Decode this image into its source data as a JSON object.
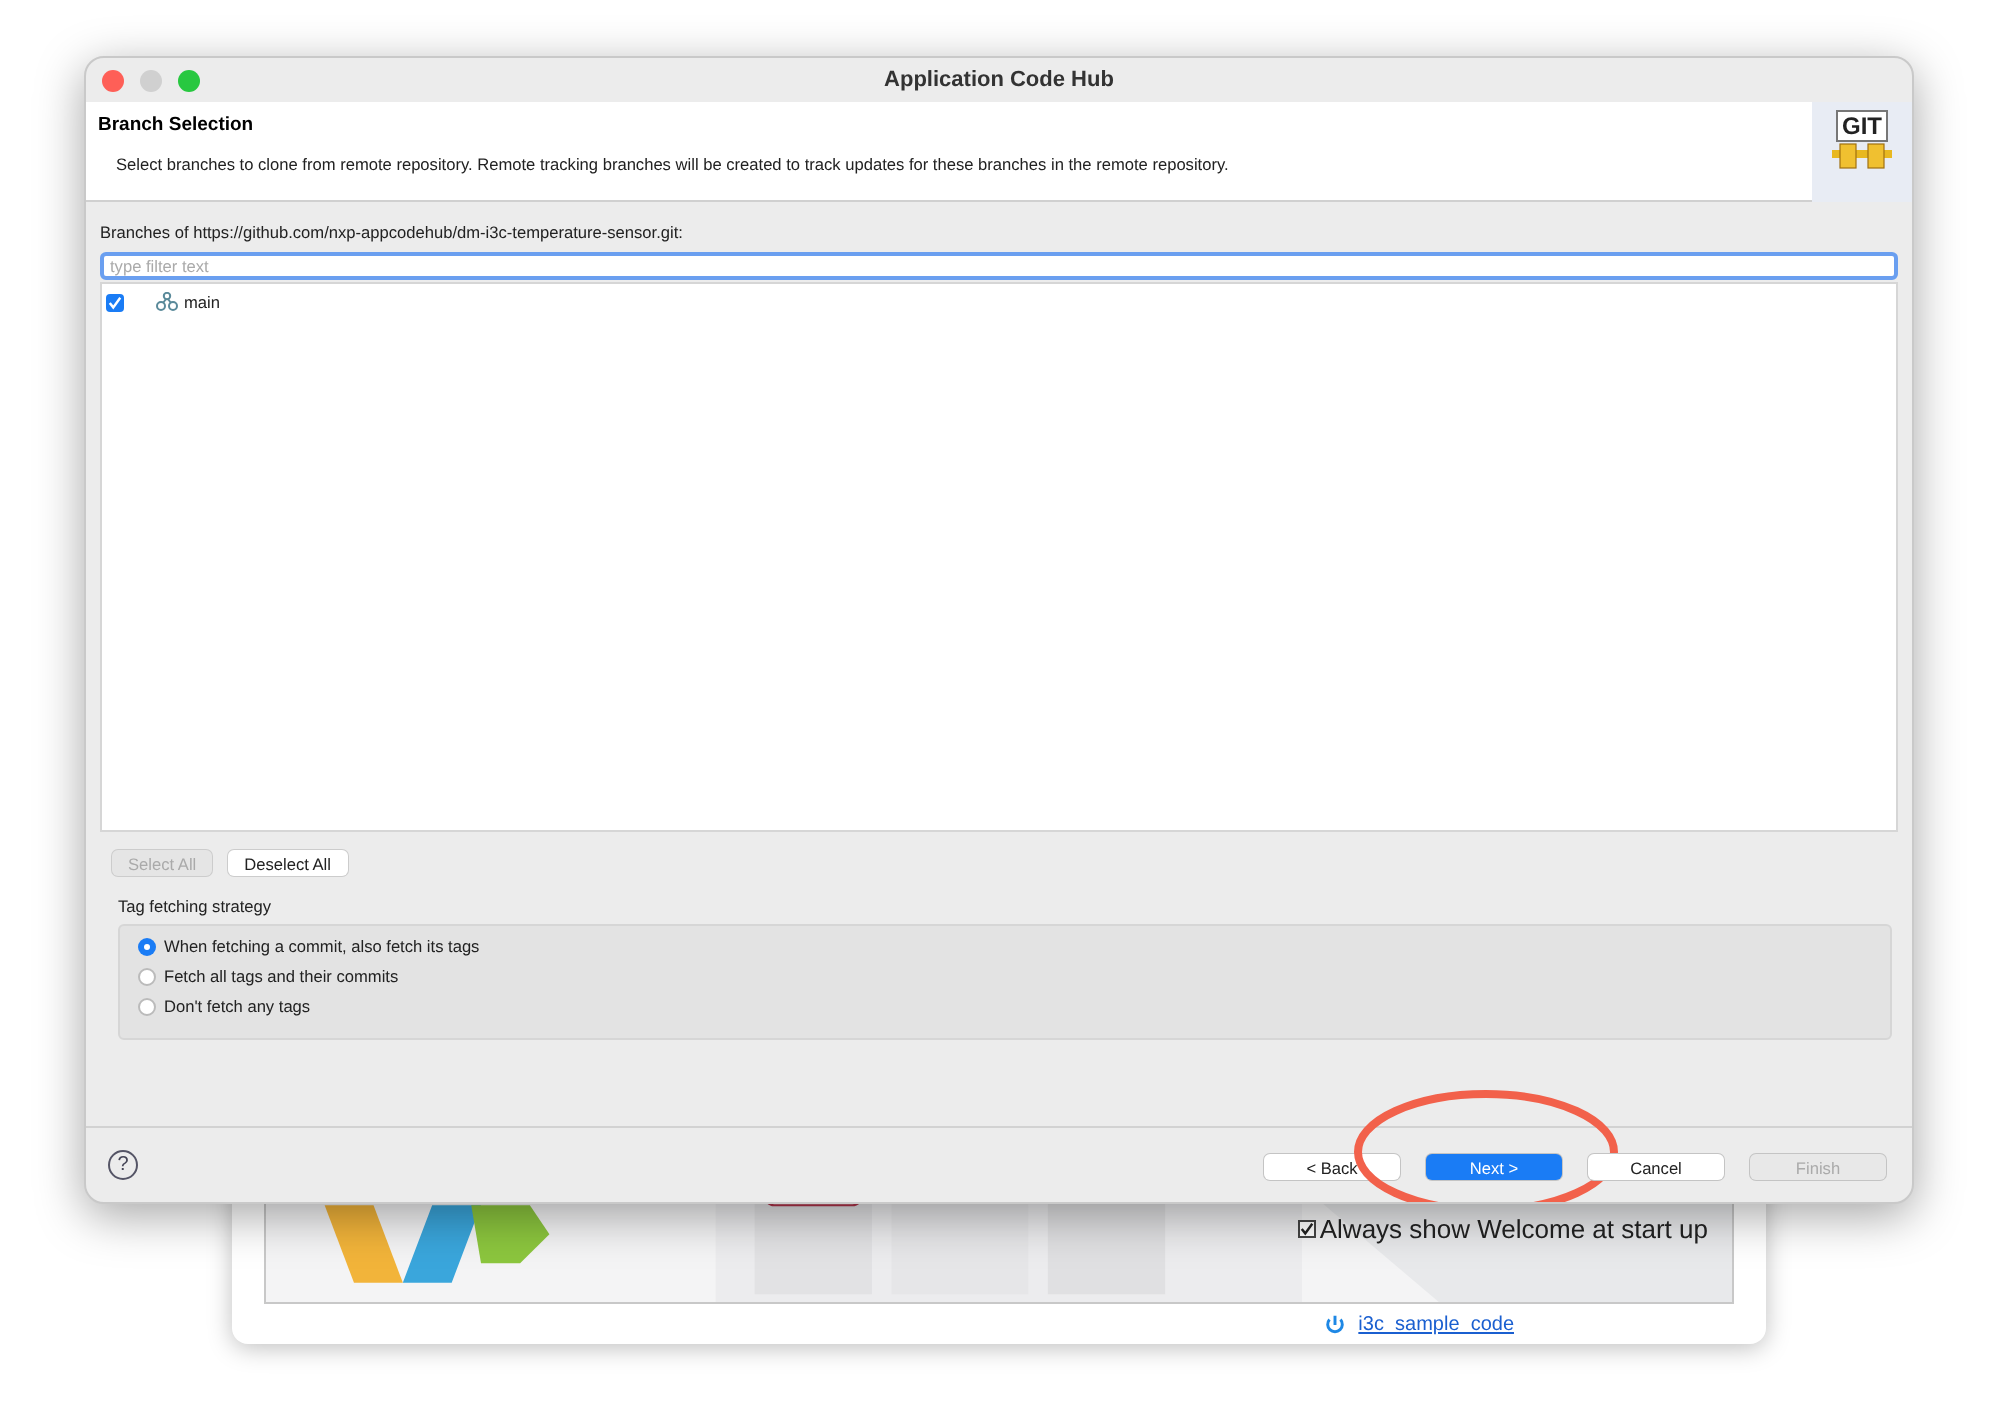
{
  "window": {
    "title": "Application Code Hub"
  },
  "header": {
    "title": "Branch Selection",
    "description": "Select branches to clone from remote repository. Remote tracking branches will be created to track updates for these branches in the remote repository.",
    "logo_text": "GIT"
  },
  "branches": {
    "label": "Branches of https://github.com/nxp-appcodehub/dm-i3c-temperature-sensor.git:",
    "filter": {
      "placeholder": "type filter text"
    },
    "items": [
      {
        "name": "main",
        "checked": true
      }
    ]
  },
  "selection_buttons": [
    {
      "label": "Select All",
      "disabled": true
    },
    {
      "label": "Deselect All",
      "disabled": false
    }
  ],
  "tag_strategy": {
    "title": "Tag fetching strategy",
    "options": [
      {
        "label": "When fetching a commit, also fetch its tags",
        "selected": true
      },
      {
        "label": "Fetch all tags and their commits",
        "selected": false
      },
      {
        "label": "Don't fetch any tags",
        "selected": false
      }
    ]
  },
  "footer_buttons": [
    {
      "label": "< Back",
      "kind": "normal",
      "disabled": false,
      "annotated": false
    },
    {
      "label": "Next >",
      "kind": "primary",
      "disabled": false,
      "annotated": true
    },
    {
      "label": "Cancel",
      "kind": "normal",
      "disabled": false,
      "annotated": false
    },
    {
      "label": "Finish",
      "kind": "normal",
      "disabled": true,
      "annotated": false
    }
  ],
  "help_button": "?",
  "background_window": {
    "welcome_checkbox": {
      "label": "Always show Welcome at start up",
      "checked": true
    },
    "project_link": "i3c_sample_code"
  }
}
